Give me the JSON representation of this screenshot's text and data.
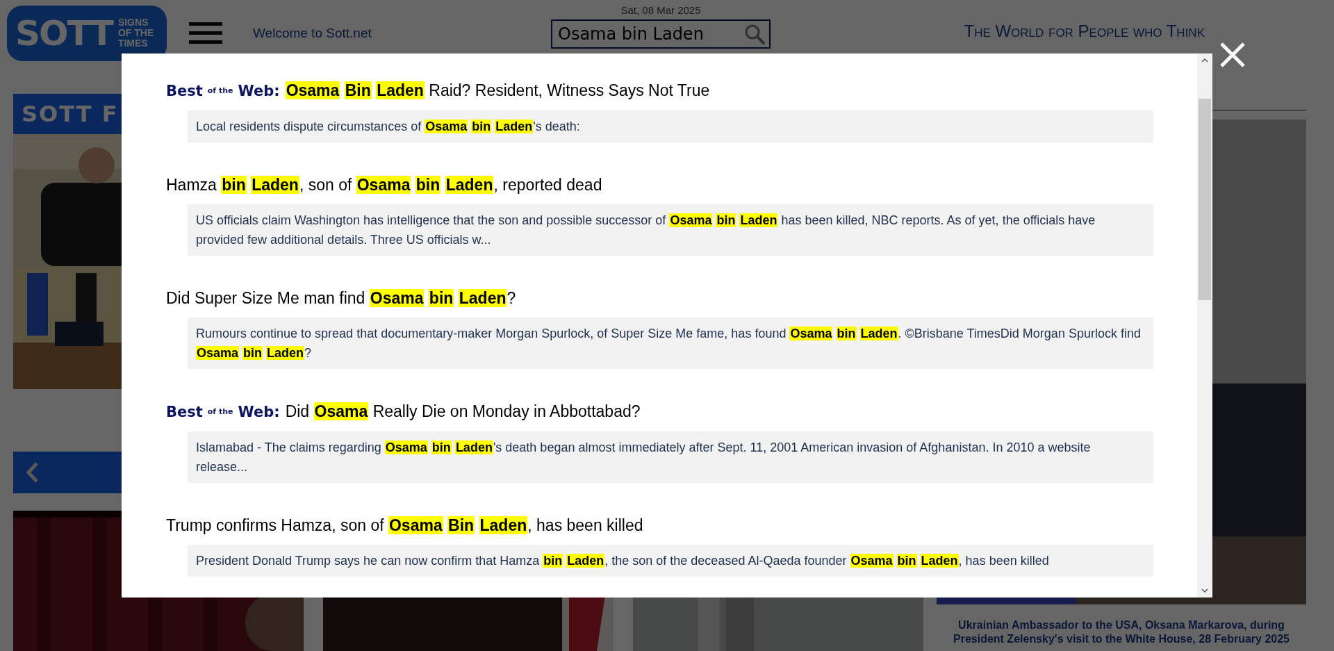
{
  "header": {
    "logo": {
      "main": "SOTT",
      "sub": [
        "SIGNS",
        "OF THE",
        "TIMES"
      ]
    },
    "welcome": "Welcome to Sott.net",
    "date": "Sat, 08 Mar 2025",
    "search": {
      "value": "Osama bin Laden"
    },
    "tagline": "The World for People who Think"
  },
  "background": {
    "feature_banner": "SOTT F",
    "caption_lines": [
      "Ukrainian Ambassador to the USA, Oksana Markarova, during",
      "President Zelensky's visit to the White House, 28 February 2025"
    ]
  },
  "search_results": [
    {
      "badge": {
        "first": "Best",
        "small": "of the",
        "last": "Web:"
      },
      "title": "**Osama** **Bin** **Laden** Raid? Resident, Witness Says Not True",
      "snippet": "Local residents dispute circumstances of **Osama** **bin** **Laden**'s death:"
    },
    {
      "title": "Hamza **bin** **Laden**, son of **Osama** **bin** **Laden**, reported dead",
      "snippet": "US officials claim Washington has intelligence that the son and possible successor of **Osama** **bin** **Laden** has been killed, NBC reports. As of yet, the officials have provided few additional details. Three US officials w..."
    },
    {
      "title": "Did Super Size Me man find **Osama** **bin** **Laden**?",
      "snippet": "Rumours continue to spread that documentary-maker Morgan Spurlock, of Super Size Me fame, has found **Osama** **bin** **Laden**. ©Brisbane TimesDid Morgan Spurlock find **Osama** **bin** **Laden**?"
    },
    {
      "badge": {
        "first": "Best",
        "small": "of the",
        "last": "Web:"
      },
      "title": "Did **Osama** Really Die on Monday in Abbottabad?",
      "snippet": "Islamabad - The claims regarding **Osama** **bin** **Laden**'s death began almost immediately after Sept. 11, 2001 American invasion of Afghanistan. In 2010 a website release..."
    },
    {
      "title": "Trump confirms Hamza, son of **Osama** **Bin** **Laden**, has been killed",
      "snippet": "President Donald Trump says he can now confirm that Hamza **bin** **Laden**, the son of the deceased Al-Qaeda founder **Osama** **bin** **Laden**, has been killed"
    }
  ]
}
